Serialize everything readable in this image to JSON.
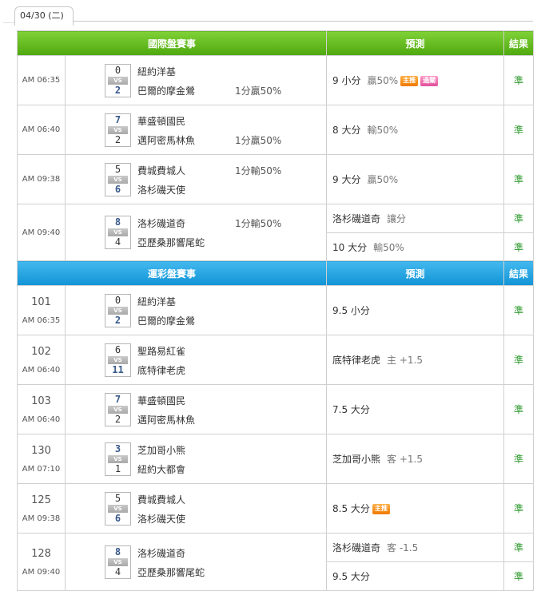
{
  "date_tab": "04/30 (二)",
  "headers": {
    "intl_title": "國際盤賽事",
    "lottery_title": "運彩盤賽事",
    "prediction": "預測",
    "result": "結果",
    "vs": "VS"
  },
  "intl_games": [
    {
      "time": "AM 06:35",
      "score_top": "0",
      "score_bottom": "2",
      "team_top": "紐約洋基",
      "team_bottom": "巴爾的摩金鶯",
      "handicap": "1分贏50%",
      "handicap_row": "bottom",
      "predictions": [
        {
          "main": "9 小分",
          "sub": "贏50%",
          "tags": [
            "主推",
            "過關"
          ],
          "result": "準"
        }
      ]
    },
    {
      "time": "AM 06:40",
      "score_top": "7",
      "score_bottom": "2",
      "team_top": "華盛頓國民",
      "team_bottom": "邁阿密馬林魚",
      "handicap": "1分贏50%",
      "handicap_row": "bottom",
      "predictions": [
        {
          "main": "8 大分",
          "sub": "輸50%",
          "tags": [],
          "result": "準"
        }
      ]
    },
    {
      "time": "AM 09:38",
      "score_top": "5",
      "score_bottom": "6",
      "team_top": "費城費城人",
      "team_bottom": "洛杉磯天使",
      "handicap": "1分輸50%",
      "handicap_row": "top",
      "predictions": [
        {
          "main": "9 大分",
          "sub": "贏50%",
          "tags": [],
          "result": "準"
        }
      ]
    },
    {
      "time": "AM 09:40",
      "score_top": "8",
      "score_bottom": "4",
      "team_top": "洛杉磯道奇",
      "team_bottom": "亞歷桑那響尾蛇",
      "handicap": "1分輸50%",
      "handicap_row": "top",
      "predictions": [
        {
          "main": "洛杉磯道奇",
          "sub": "讓分",
          "tags": [],
          "result": "準"
        },
        {
          "main": "10 大分",
          "sub": "輸50%",
          "tags": [],
          "result": "準"
        }
      ]
    }
  ],
  "lottery_games": [
    {
      "num": "101",
      "time": "AM 06:35",
      "score_top": "0",
      "score_bottom": "2",
      "team_top": "紐約洋基",
      "team_bottom": "巴爾的摩金鶯",
      "predictions": [
        {
          "main": "9.5 小分",
          "sub": "",
          "tags": [],
          "result": "準"
        }
      ]
    },
    {
      "num": "102",
      "time": "AM 06:40",
      "score_top": "6",
      "score_bottom": "11",
      "team_top": "聖路易紅雀",
      "team_bottom": "底特律老虎",
      "predictions": [
        {
          "main": "底特律老虎",
          "sub": "主 +1.5",
          "tags": [],
          "result": "準"
        }
      ]
    },
    {
      "num": "103",
      "time": "AM 06:40",
      "score_top": "7",
      "score_bottom": "2",
      "team_top": "華盛頓國民",
      "team_bottom": "邁阿密馬林魚",
      "predictions": [
        {
          "main": "7.5 大分",
          "sub": "",
          "tags": [],
          "result": "準"
        }
      ]
    },
    {
      "num": "130",
      "time": "AM 07:10",
      "score_top": "3",
      "score_bottom": "1",
      "team_top": "芝加哥小熊",
      "team_bottom": "紐約大都會",
      "predictions": [
        {
          "main": "芝加哥小熊",
          "sub": "客 +1.5",
          "tags": [],
          "result": "準"
        }
      ]
    },
    {
      "num": "125",
      "time": "AM 09:38",
      "score_top": "5",
      "score_bottom": "6",
      "team_top": "費城費城人",
      "team_bottom": "洛杉磯天使",
      "predictions": [
        {
          "main": "8.5 大分",
          "sub": "",
          "tags": [
            "主推"
          ],
          "result": "準"
        }
      ]
    },
    {
      "num": "128",
      "time": "AM 09:40",
      "score_top": "8",
      "score_bottom": "4",
      "team_top": "洛杉磯道奇",
      "team_bottom": "亞歷桑那響尾蛇",
      "predictions": [
        {
          "main": "洛杉磯道奇",
          "sub": "客 -1.5",
          "tags": [],
          "result": "準"
        },
        {
          "main": "9.5 大分",
          "sub": "",
          "tags": [],
          "result": "準"
        }
      ]
    }
  ]
}
